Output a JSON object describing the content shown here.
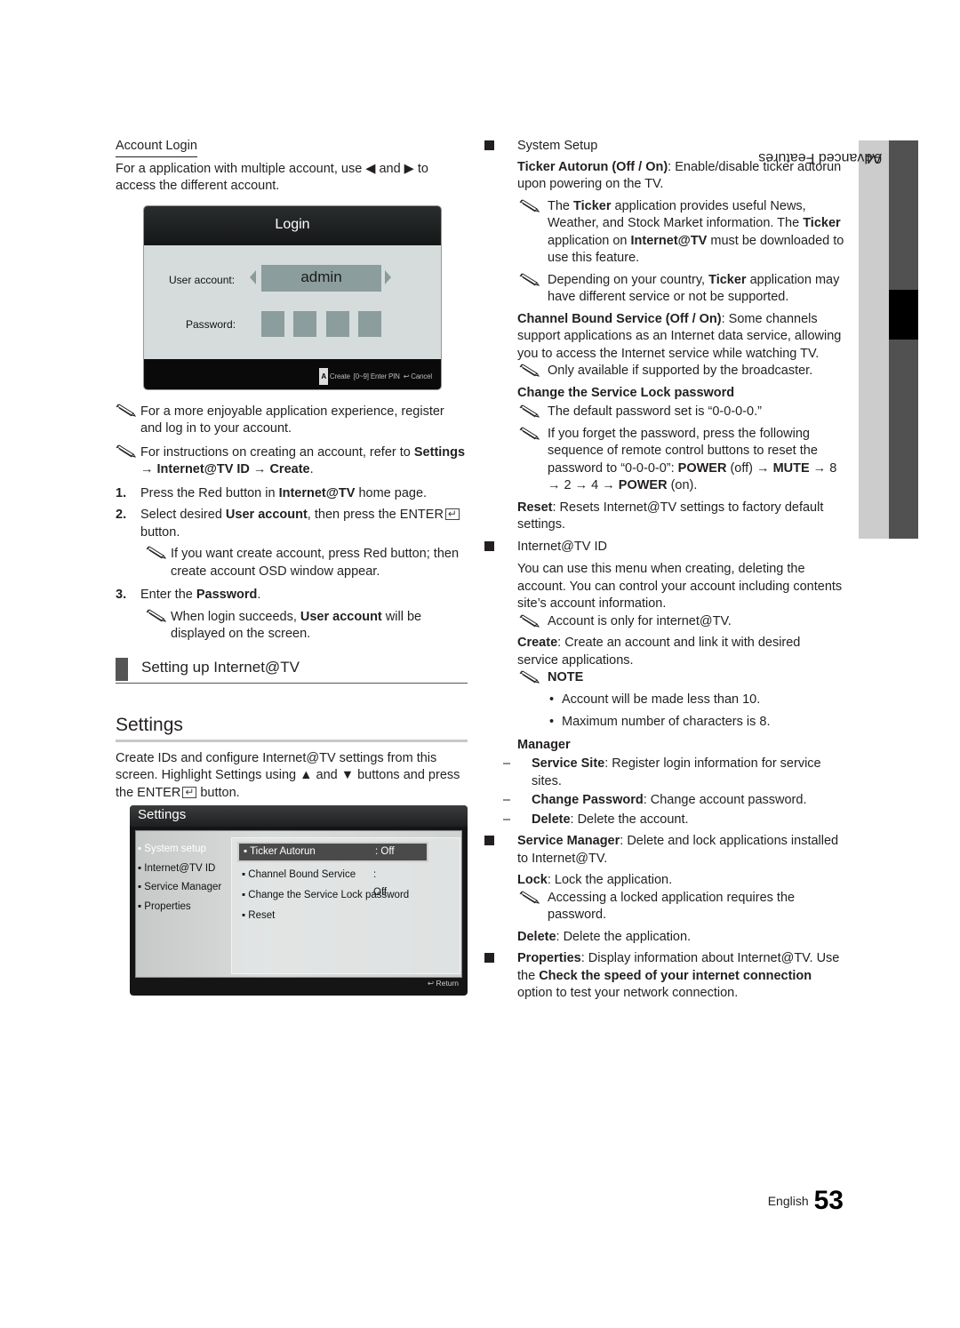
{
  "left": {
    "account_login": {
      "heading": "Account Login",
      "intro": "For a application with multiple account, use ◀ and ▶ to access the different account."
    },
    "login_osd": {
      "title": "Login",
      "user_account_label": "User account:",
      "user_account_value": "admin",
      "password_label": "Password:",
      "pin_boxes": 4,
      "footer_key": "A",
      "footer_create": "Create",
      "footer_pin": "[0~9] Enter PIN",
      "footer_return_icon": "↩",
      "footer_cancel": "Cancel"
    },
    "notes": [
      {
        "text": "For a more enjoyable application experience, register and log in to your account."
      },
      {
        "pre": "For instructions on creating an account, refer to ",
        "bold": "Settings → Internet@TV ID → Create",
        "post": "."
      }
    ],
    "steps": [
      {
        "num": "1.",
        "pre": "Press the Red button in ",
        "bold": "Internet@TV",
        "post": " home page."
      },
      {
        "num": "2.",
        "pre": "Select desired ",
        "bold": "User account",
        "mid": ", then press the ENTER",
        "post": " button."
      },
      {
        "num": "3.",
        "pre": "Enter the ",
        "bold": "Password",
        "post": "."
      }
    ],
    "step2_note": "If you want create account, press Red button; then create account OSD window appear.",
    "step3_note": {
      "pre": "When login succeeds, ",
      "bold": "User account",
      "post": " will be displayed on the screen."
    },
    "section_heading": "Setting up Internet@TV",
    "settings_heading": "Settings",
    "settings_intro_1": "Create IDs and configure Internet@TV settings from this screen. Highlight Settings using ▲ and ▼ buttons and press the ENTER",
    "settings_intro_2": " button.",
    "settings_osd": {
      "title": "Settings",
      "menu": [
        "▪ System setup",
        "▪ Internet@TV ID",
        "▪ Service Manager",
        "▪ Properties"
      ],
      "active_menu_index": 0,
      "options": [
        {
          "label": "▪ Ticker Autorun",
          "value": ": Off"
        },
        {
          "label": "▪ Channel Bound Service",
          "value": ": Off"
        },
        {
          "label": "▪ Change the Service Lock password",
          "value": ""
        },
        {
          "label": "▪ Reset",
          "value": ""
        }
      ],
      "footer_return": "↩ Return"
    }
  },
  "right": {
    "system_setup": {
      "heading": "System Setup",
      "ticker_bold": "Ticker Autorun (Off / On)",
      "ticker_text": ": Enable/disable ticker autorun upon powering on the TV.",
      "note1_pre": "The ",
      "note1_b1": "Ticker",
      "note1_mid": " application provides useful News, Weather, and Stock Market information. The ",
      "note1_b2": "Ticker",
      "note1_mid2": " application on ",
      "note1_b3": "Internet@TV",
      "note1_post": " must be downloaded to use this feature.",
      "note2_pre": "Depending on your country, ",
      "note2_bold": "Ticker",
      "note2_post": " application may have different service or not be supported.",
      "cbs_bold": "Channel Bound Service (Off / On)",
      "cbs_text": ": Some channels support applications as an Internet data service, allowing you to access the Internet service while watching TV.",
      "cbs_note": "Only available if supported by the broadcaster.",
      "lock_heading": "Change the Service Lock password",
      "lock_note1": "The default password set is “0-0-0-0.”",
      "lock_note2_pre": "If you forget the password, press the following sequence of remote control buttons to reset the password to “0-0-0-0”: ",
      "lock_note2_b1": "POWER",
      "lock_note2_m1": " (off) → ",
      "lock_note2_b2": "MUTE",
      "lock_note2_m2": " → 8 → 2 → 4 → ",
      "lock_note2_b3": "POWER",
      "lock_note2_post": " (on).",
      "reset_bold": "Reset",
      "reset_text": ": Resets Internet@TV settings to factory default settings."
    },
    "internet_id": {
      "heading": "Internet@TV ID",
      "text": "You can use this menu when creating, deleting the account. You can control your account including contents site’s account information.",
      "note": "Account is only for internet@TV.",
      "create_bold": "Create",
      "create_text": ": Create an account and link it with desired service applications.",
      "note_heading": "NOTE",
      "note_items": [
        "Account will be made less than 10.",
        "Maximum number of characters is 8."
      ],
      "manager_heading": "Manager",
      "manager_items": [
        {
          "bold": "Service Site",
          "text": ": Register login information for service sites."
        },
        {
          "bold": "Change Password",
          "text": ": Change account password."
        },
        {
          "bold": "Delete",
          "text": ": Delete the account."
        }
      ]
    },
    "service_manager": {
      "bold": "Service Manager",
      "text": ": Delete and lock applications installed to Internet@TV.",
      "lock_bold": "Lock",
      "lock_text": ": Lock the application.",
      "lock_note": "Accessing a locked application requires the password.",
      "delete_bold": "Delete",
      "delete_text": ": Delete the application."
    },
    "properties": {
      "bold": "Properties",
      "text1": ": Display information about Internet@TV. Use the ",
      "bold2": "Check the speed of your internet connection",
      "text2": " option to test your network connection."
    }
  },
  "side_tab": {
    "chapter": "04",
    "title": "Advanced Features"
  },
  "footer": {
    "language": "English",
    "page_number": "53"
  },
  "icons": {
    "note": "pencil-note-icon",
    "bullet": "square-bullet-icon",
    "enter": "enter-key-icon",
    "return": "return-icon"
  }
}
